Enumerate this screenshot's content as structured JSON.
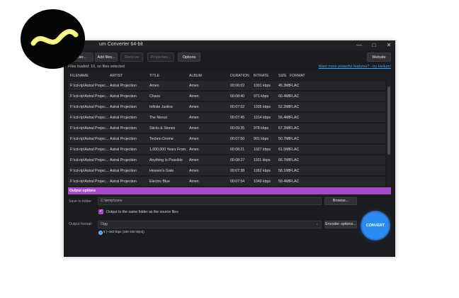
{
  "window": {
    "title": "Helium Converter 64-bit",
    "title_visible": "um Converter 64-bit",
    "controls": [
      "—",
      "□",
      "✕"
    ]
  },
  "toolbar": {
    "add_folder": "Add folder...",
    "add_folder_visible": "folder...",
    "add_files": "Add files...",
    "remove": "Remove",
    "properties": "Properties...",
    "options": "Options",
    "website": "Website"
  },
  "status": {
    "files_loaded": "Files loaded: 10, no files selected",
    "more_features_link": "Want more powerful features? - try Helium!"
  },
  "table": {
    "columns": [
      "FILENAME",
      "ARTIST",
      "TITLE",
      "ALBUM",
      "DURATION",
      "BITRATE",
      "SIZE",
      "FORMAT"
    ],
    "rows": [
      [
        "F:\\cd-rip\\Astral Projec...",
        "Astral Projection",
        "Amen",
        "Amen",
        "00:06:02",
        "1001 kbps",
        "45.3MB",
        "FLAC"
      ],
      [
        "F:\\cd-rip\\Astral Projec...",
        "Astral Projection",
        "Chaos",
        "Amen",
        "00:08:40",
        "971 kbps",
        "60.4MB",
        "FLAC"
      ],
      [
        "F:\\cd-rip\\Astral Projec...",
        "Astral Projection",
        "Infinite Justice",
        "Amen",
        "00:07:02",
        "1035 kbps",
        "52.2MB",
        "FLAC"
      ],
      [
        "F:\\cd-rip\\Astral Projec...",
        "Astral Projection",
        "The Nexus",
        "Amen",
        "00:07:45",
        "1014 kbps",
        "56.4MB",
        "FLAC"
      ],
      [
        "F:\\cd-rip\\Astral Projec...",
        "Astral Projection",
        "Sticks & Stones",
        "Amen",
        "00:09:35",
        "978 kbps",
        "67.2MB",
        "FLAC"
      ],
      [
        "F:\\cd-rip\\Astral Projec...",
        "Astral Projection",
        "Techno Drome",
        "Amen",
        "00:07:50",
        "901 kbps",
        "50.7MB",
        "FLAC"
      ],
      [
        "F:\\cd-rip\\Astral Projec...",
        "Astral Projection",
        "1,000,000 Years From...",
        "Amen",
        "00:08:21",
        "1027 kbps",
        "61.5MB",
        "FLAC"
      ],
      [
        "F:\\cd-rip\\Astral Projec...",
        "Astral Projection",
        "Anything Is Possible",
        "Amen",
        "00:08:27",
        "1101 kbps",
        "66.7MB",
        "FLAC"
      ],
      [
        "F:\\cd-rip\\Astral Projec...",
        "Astral Projection",
        "Heaven's Gate",
        "Amen",
        "00:07:38",
        "1062 kbps",
        "58.1MB",
        "FLAC"
      ],
      [
        "F:\\cd-rip\\Astral Projec...",
        "Astral Projection",
        "Electric Blue",
        "Amen",
        "00:07:54",
        "1049 kbps",
        "59.4MB",
        "FLAC"
      ]
    ]
  },
  "output": {
    "header": "Output options",
    "save_to_folder_label": "Save to folder",
    "save_to_folder_value": "C:\\temp\\conv",
    "browse": "Browse...",
    "same_folder_label": "Output to the same folder as the source files",
    "same_folder_checked": true,
    "format_label": "Output format:",
    "format_value": "Ogg",
    "encoder_options": "Encoder options...",
    "quality_label": "5 (~160 kbps (160-192 kbps))",
    "convert": "CONVERT"
  },
  "colors": {
    "accent": "#a64bc8",
    "convert_button": "#2a8cf0",
    "link": "#4a9ff0",
    "window_bg": "#1b1c1f"
  },
  "logo": {
    "icon": "helium-logo-icon"
  }
}
